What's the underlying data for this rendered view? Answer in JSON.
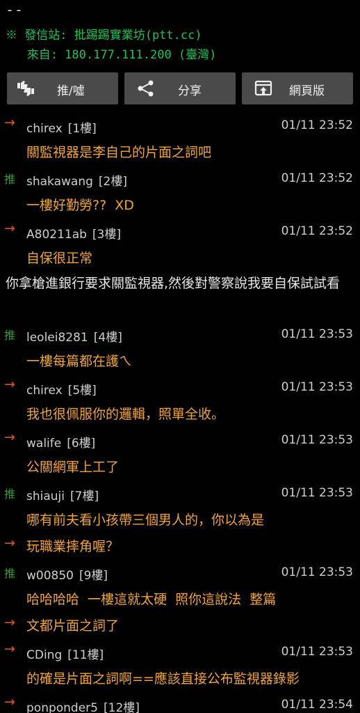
{
  "signature": {
    "dash": "--",
    "source_line": "※ 發信站: 批踢踢實業坊(ptt.cc)",
    "from_line": "   來自: 180.177.111.200 (臺灣)"
  },
  "toolbar": {
    "push_label": "推/噓",
    "share_label": "分享",
    "web_label": "網頁版"
  },
  "comments": [
    {
      "tag": "→",
      "type": "arrow",
      "user": "chirex",
      "floor": "[1樓]",
      "time": "01/11 23:52",
      "text": "關監視器是李自己的片面之詞吧"
    },
    {
      "tag": "推",
      "type": "push",
      "user": "shakawang",
      "floor": "[2樓]",
      "time": "01/11 23:52",
      "text": "一樓好勤勞??  XD"
    },
    {
      "tag": "→",
      "type": "arrow",
      "user": "A80211ab",
      "floor": "[3樓]",
      "time": "01/11 23:52",
      "text": "自保很正常"
    },
    {
      "tag": "推",
      "type": "push",
      "user": "leolei8281",
      "floor": "[4樓]",
      "time": "01/11 23:53",
      "text": "一樓每篇都在護ㄟ"
    },
    {
      "tag": "→",
      "type": "arrow",
      "user": "chirex",
      "floor": "[5樓]",
      "time": "01/11 23:53",
      "text": "我也很佩服你的邏輯，照單全收。"
    },
    {
      "tag": "→",
      "type": "arrow",
      "user": "walife",
      "floor": "[6樓]",
      "time": "01/11 23:53",
      "text": "公關網軍上工了"
    },
    {
      "tag": "推",
      "type": "push",
      "user": "shiauji",
      "floor": "[7樓]",
      "time": "01/11 23:53",
      "text": "哪有前夫看小孩帶三個男人的，你以為是",
      "cont": "玩職業摔角喔？"
    },
    {
      "tag": "推",
      "type": "push",
      "user": "w00850",
      "floor": "[9樓]",
      "time": "01/11 23:53",
      "text": "哈哈哈哈  一樓這就太硬  照你這說法  整篇",
      "cont": "文都片面之詞了"
    },
    {
      "tag": "→",
      "type": "arrow",
      "user": "CDing",
      "floor": "[11樓]",
      "time": "01/11 23:53",
      "text": "的確是片面之詞啊==應該直接公布監視器錄影"
    },
    {
      "tag": "→",
      "type": "arrow",
      "user": "ponponder5",
      "floor": "[12樓]",
      "time": "01/11 23:54",
      "text": ""
    }
  ],
  "note": "你拿槍進銀行要求關監視器,然後對警察說我要自保試試看",
  "colors": {
    "background": "#000000",
    "signature": "#21c25a",
    "comment_text": "#f0a43a",
    "arrow": "#d9541e",
    "push": "#2aa02a",
    "button": "#4a4a4a"
  }
}
